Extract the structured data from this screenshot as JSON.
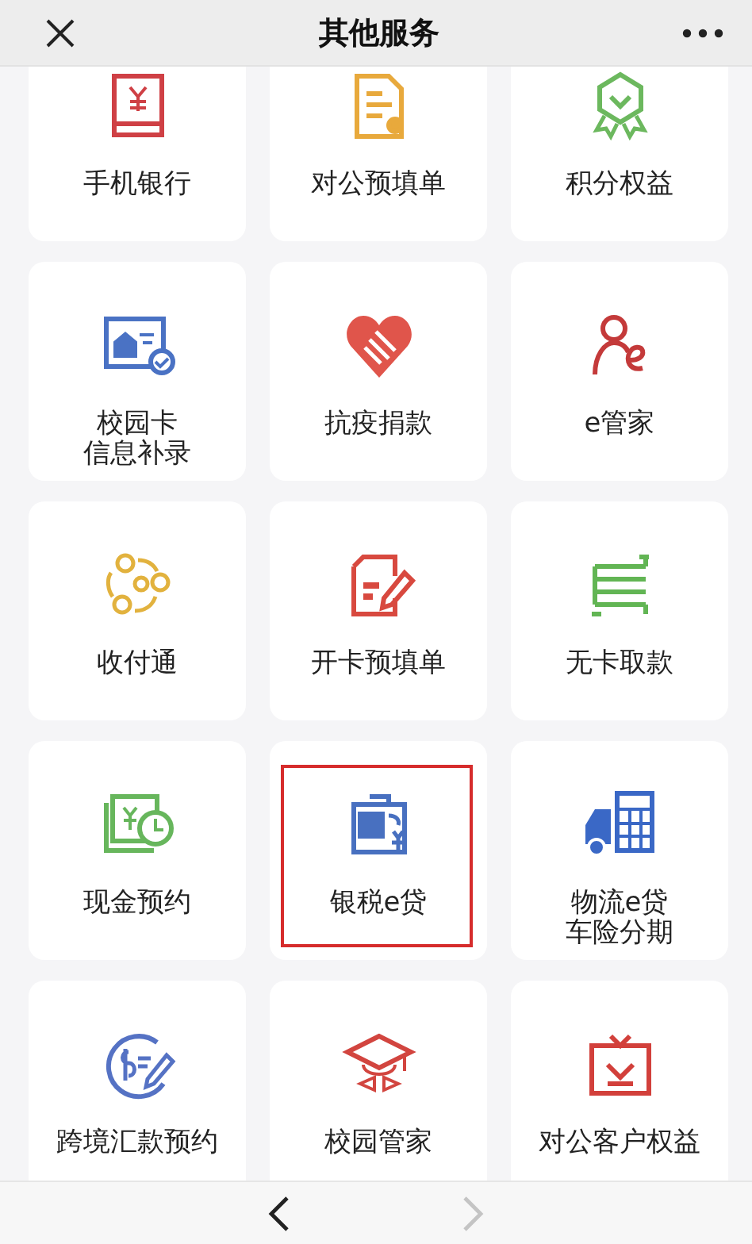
{
  "header": {
    "title": "其他服务"
  },
  "services": [
    {
      "label": "手机银行",
      "highlighted": false
    },
    {
      "label": "对公预填单",
      "highlighted": false
    },
    {
      "label": "积分权益",
      "highlighted": false
    },
    {
      "label": [
        "校园卡",
        "信息补录"
      ],
      "highlighted": false
    },
    {
      "label": "抗疫捐款",
      "highlighted": false
    },
    {
      "label": "e管家",
      "highlighted": false
    },
    {
      "label": "收付通",
      "highlighted": false
    },
    {
      "label": "开卡预填单",
      "highlighted": false
    },
    {
      "label": "无卡取款",
      "highlighted": false
    },
    {
      "label": "现金预约",
      "highlighted": false
    },
    {
      "label": "银税e贷",
      "highlighted": true
    },
    {
      "label": [
        "物流e贷",
        "车险分期"
      ],
      "highlighted": false
    },
    {
      "label": "跨境汇款预约",
      "highlighted": false
    },
    {
      "label": "校园管家",
      "highlighted": false
    },
    {
      "label": "对公客户权益",
      "highlighted": false
    }
  ],
  "navigation": {
    "back": {
      "disabled": false
    },
    "forward": {
      "disabled": true
    }
  }
}
